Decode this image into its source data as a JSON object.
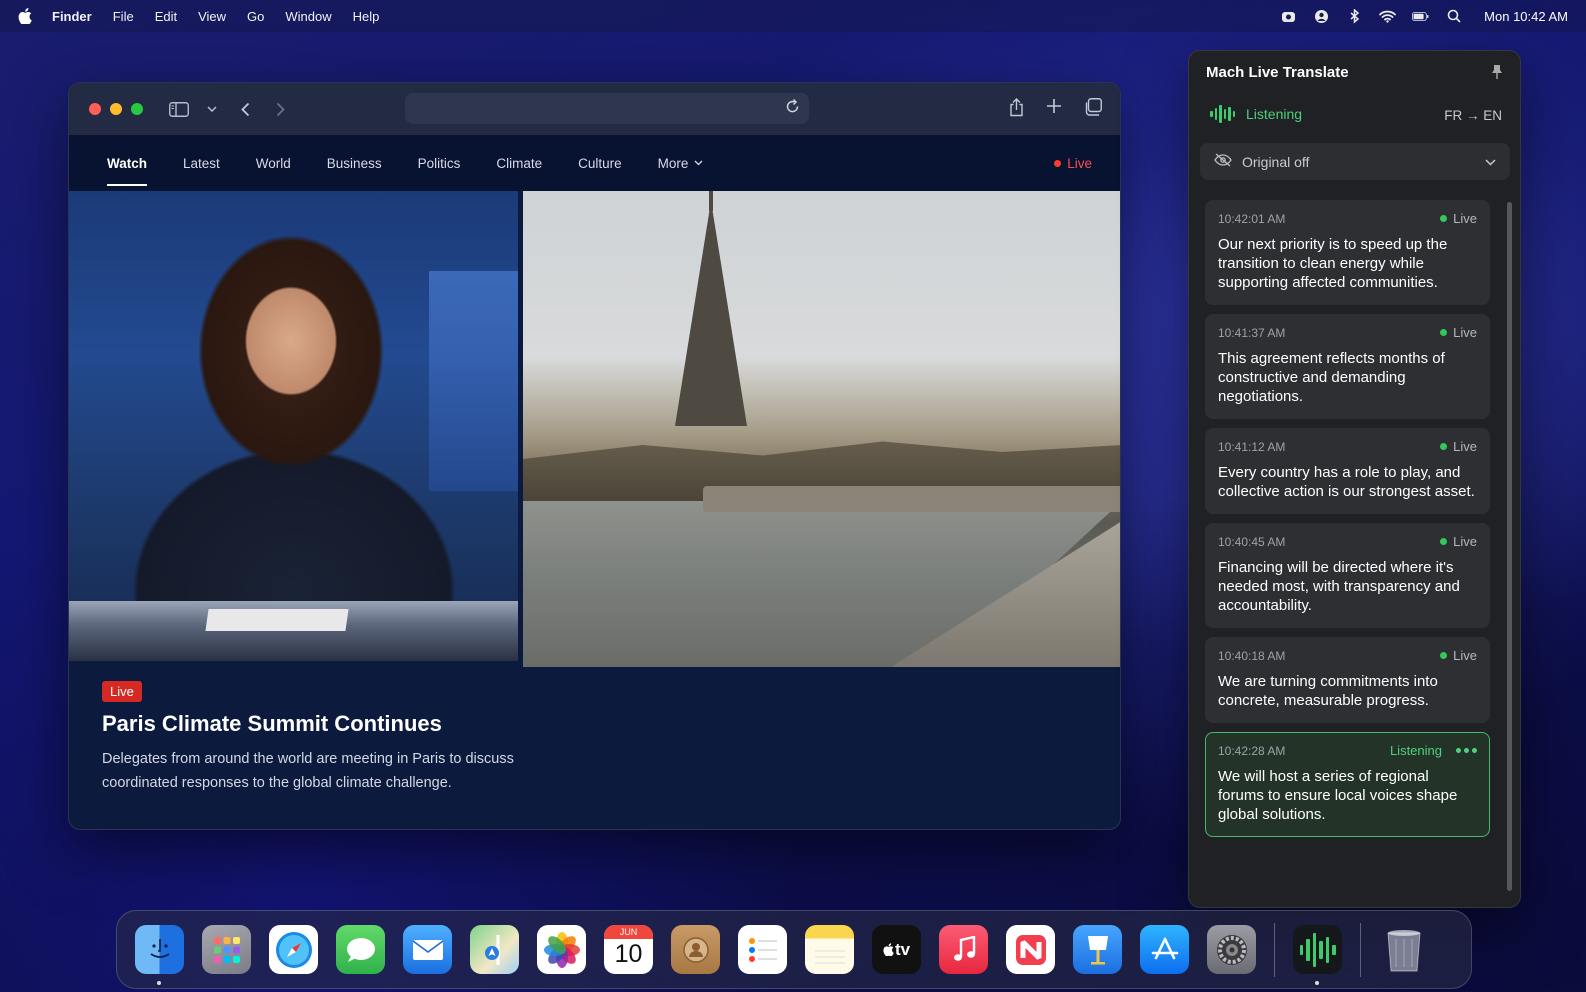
{
  "menubar": {
    "app": "Finder",
    "items": [
      "File",
      "Edit",
      "View",
      "Go",
      "Window",
      "Help"
    ],
    "clock": "Mon 10:42 AM"
  },
  "browser": {
    "nav": {
      "tabs": [
        "Watch",
        "Latest",
        "World",
        "Business",
        "Politics",
        "Climate",
        "Culture",
        "More"
      ],
      "active_tab": "Watch",
      "live": "Live"
    },
    "article": {
      "badge": "Live",
      "title": "Paris Climate Summit Continues",
      "description": "Delegates from around the world are meeting in Paris to discuss coordinated responses to the global climate challenge."
    }
  },
  "translate": {
    "title": "Mach Live Translate",
    "status": "Listening",
    "language_pair": "FR → EN",
    "original_select": "Original off",
    "entries": [
      {
        "time": "10:42:01 AM",
        "tag": "Live",
        "text": "Our next priority is to speed up the transition to clean energy while supporting affected communities."
      },
      {
        "time": "10:41:37 AM",
        "tag": "Live",
        "text": "This agreement reflects months of constructive and demanding negotiations."
      },
      {
        "time": "10:41:12 AM",
        "tag": "Live",
        "text": "Every country has a role to play, and collective action is our strongest asset."
      },
      {
        "time": "10:40:45 AM",
        "tag": "Live",
        "text": "Financing will be directed where it's needed most, with transparency and accountability."
      },
      {
        "time": "10:40:18 AM",
        "tag": "Live",
        "text": "We are turning commitments into concrete, measurable progress."
      },
      {
        "time": "10:42:28 AM",
        "tag": "Listening",
        "text": "We will host a series of regional forums to ensure local voices shape global solutions."
      }
    ]
  },
  "dock": {
    "calendar_month": "JUN",
    "calendar_day": "10",
    "tv_label": "tv",
    "apps": [
      {
        "name": "finder",
        "color": "#3a8dee"
      },
      {
        "name": "launchpad",
        "color": "#8e8e96"
      },
      {
        "name": "safari",
        "color": "#2f7fe6"
      },
      {
        "name": "messages",
        "color": "#3cc25a"
      },
      {
        "name": "mail",
        "color": "#2b86f0"
      },
      {
        "name": "maps",
        "color": "#4aa864"
      },
      {
        "name": "photos",
        "color": "#f2f2f2"
      },
      {
        "name": "calendar",
        "color": "#ffffff"
      },
      {
        "name": "contacts",
        "color": "#b98c5a"
      },
      {
        "name": "reminders",
        "color": "#f4f4f4"
      },
      {
        "name": "notes",
        "color": "#f6d85a"
      },
      {
        "name": "tv",
        "color": "#111111"
      },
      {
        "name": "music",
        "color": "#f0394f"
      },
      {
        "name": "news",
        "color": "#f33e4f"
      },
      {
        "name": "keynote",
        "color": "#2e8de8"
      },
      {
        "name": "app-store",
        "color": "#1c84f3"
      },
      {
        "name": "system-settings",
        "color": "#8a8a90"
      },
      {
        "name": "mach-live-translate",
        "color": "#1a1d20"
      },
      {
        "name": "trash",
        "color": "#9a9ca4"
      }
    ]
  }
}
